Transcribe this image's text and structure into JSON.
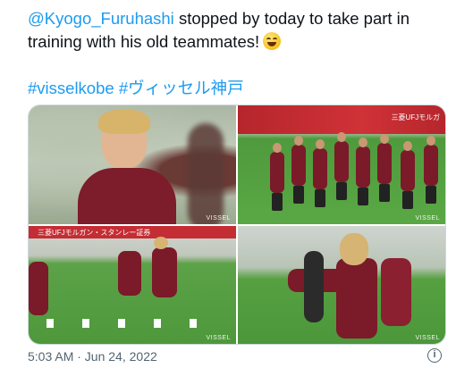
{
  "tweet": {
    "mention": "@Kyogo_Furuhashi",
    "text_after_mention": "stopped by today to take part in",
    "text_line2": "training with his old teammates!",
    "emoji": "grinning-face-with-smiling-eyes",
    "hashtag1": "#visselkobe",
    "hashtag2": "#ヴィッセル神戸"
  },
  "media": {
    "photos": [
      {
        "description": "smiling-player-portrait",
        "watermark": "VISSEL"
      },
      {
        "description": "team-running-drill",
        "watermark": "VISSEL",
        "banner_text": "三菱UFJモルガ"
      },
      {
        "description": "player-kick-drill",
        "watermark": "VISSEL",
        "banner_text": "三菱UFJモルガン・スタンレー証券"
      },
      {
        "description": "player-pointing",
        "watermark": "VISSEL"
      }
    ]
  },
  "footer": {
    "timestamp": "5:03 AM · Jun 24, 2022",
    "info_icon": "info-icon",
    "info_glyph": "i"
  },
  "colors": {
    "link": "#1d9bf0",
    "text": "#0f1419",
    "muted": "#536471",
    "kit": "#7b1a29"
  }
}
